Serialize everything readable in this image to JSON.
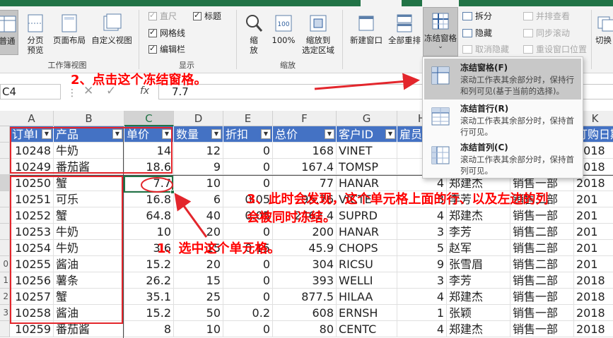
{
  "ribbon": {
    "view_group": {
      "label": "工作簿视图",
      "normal": "普通",
      "page_break": "分页\n预览",
      "page_layout": "页面布局",
      "custom_view": "自定义视图"
    },
    "show_group": {
      "label": "显示",
      "ruler": "直尺",
      "formula_bar": "编辑栏",
      "gridlines": "网格线",
      "headings": "标题"
    },
    "zoom_group": {
      "label": "缩放",
      "zoom": "缩\n放",
      "hundred": "100%",
      "zoom_selection": "缩放到\n选定区域"
    },
    "window_group": {
      "new_window": "新建窗口",
      "arrange_all": "全部重排",
      "freeze_panes": "冻结窗格",
      "split": "拆分",
      "hide": "隐藏",
      "unhide": "取消隐藏",
      "view_side": "并排查看",
      "sync_scroll": "同步滚动",
      "reset_pos": "重设窗口位置",
      "switch": "切换"
    }
  },
  "formula_bar": {
    "name_box": "C4",
    "dots": "⋮",
    "cancel": "✕",
    "enter": "✓",
    "fx": "fx",
    "value": "7.7"
  },
  "columns": [
    "A",
    "B",
    "C",
    "D",
    "E",
    "F",
    "G",
    "H",
    "I",
    "J",
    "K"
  ],
  "row_numbers": [
    "",
    "",
    "",
    "",
    "",
    "",
    "",
    "",
    "0",
    "1",
    "2",
    "3"
  ],
  "table": {
    "headers": [
      "订单I",
      "产品",
      "单价",
      "数量",
      "折扣",
      "总价",
      "客户ID",
      "雇员",
      "",
      "",
      "订购日期"
    ],
    "rows": [
      [
        "10248",
        "牛奶",
        "14",
        "12",
        "0",
        "168",
        "VINET",
        "",
        "",
        "",
        "2018"
      ],
      [
        "10249",
        "番茄酱",
        "18.6",
        "9",
        "0",
        "167.4",
        "TOMSP",
        "",
        "",
        "",
        "2018"
      ],
      [
        "10250",
        "蟹",
        "7.7",
        "10",
        "0",
        "77",
        "HANAR",
        "4",
        "郑建杰",
        "销售一部",
        "2018"
      ],
      [
        "10251",
        "可乐",
        "16.8",
        "6",
        "0.05",
        "95.76",
        "VICTE",
        "3",
        "李芳",
        "销售二部",
        "201"
      ],
      [
        "10252",
        "蟹",
        "64.8",
        "40",
        "0.05",
        "2462.4",
        "SUPRD",
        "4",
        "郑建杰",
        "销售一部",
        "201"
      ],
      [
        "10253",
        "牛奶",
        "10",
        "20",
        "0",
        "200",
        "HANAR",
        "3",
        "李芳",
        "销售二部",
        "201"
      ],
      [
        "10254",
        "牛奶",
        "3.6",
        "15",
        "0.15",
        "45.9",
        "CHOPS",
        "5",
        "赵军",
        "销售二部",
        "201"
      ],
      [
        "10255",
        "酱油",
        "15.2",
        "20",
        "0",
        "304",
        "RICSU",
        "9",
        "张雪眉",
        "销售二部",
        "201"
      ],
      [
        "10256",
        "薯条",
        "26.2",
        "15",
        "0",
        "393",
        "WELLI",
        "3",
        "李芳",
        "销售二部",
        "2018"
      ],
      [
        "10257",
        "蟹",
        "35.1",
        "25",
        "0",
        "877.5",
        "HILAA",
        "4",
        "郑建杰",
        "销售一部",
        "2018"
      ],
      [
        "10258",
        "酱油",
        "15.2",
        "50",
        "0.2",
        "608",
        "ERNSH",
        "1",
        "张颖",
        "销售一部",
        "2018"
      ],
      [
        "10259",
        "番茄酱",
        "8",
        "10",
        "0",
        "80",
        "CENTC",
        "4",
        "郑建杰",
        "销售一部",
        "2018"
      ]
    ]
  },
  "freeze_menu": {
    "items": [
      {
        "title": "冻结窗格(F)",
        "desc": "滚动工作表其余部分时，保持行和列可见(基于当前的选择)。"
      },
      {
        "title": "冻结首行(R)",
        "desc": "滚动工作表其余部分时，保持首行可见。"
      },
      {
        "title": "冻结首列(C)",
        "desc": "滚动工作表其余部分时，保持首列可见。"
      }
    ]
  },
  "annotations": {
    "step1": "1、选中这个单元格。",
    "step2": "2、点击这个冻结窗格。",
    "step3_line1": "3、此时会发现，这个单元格上面的行、以及左边的列",
    "step3_line2": "会被同时冻结。"
  },
  "colors": {
    "accent_green": "#217346",
    "table_header_blue": "#4472c4",
    "annotation_red": "#ff0000"
  }
}
